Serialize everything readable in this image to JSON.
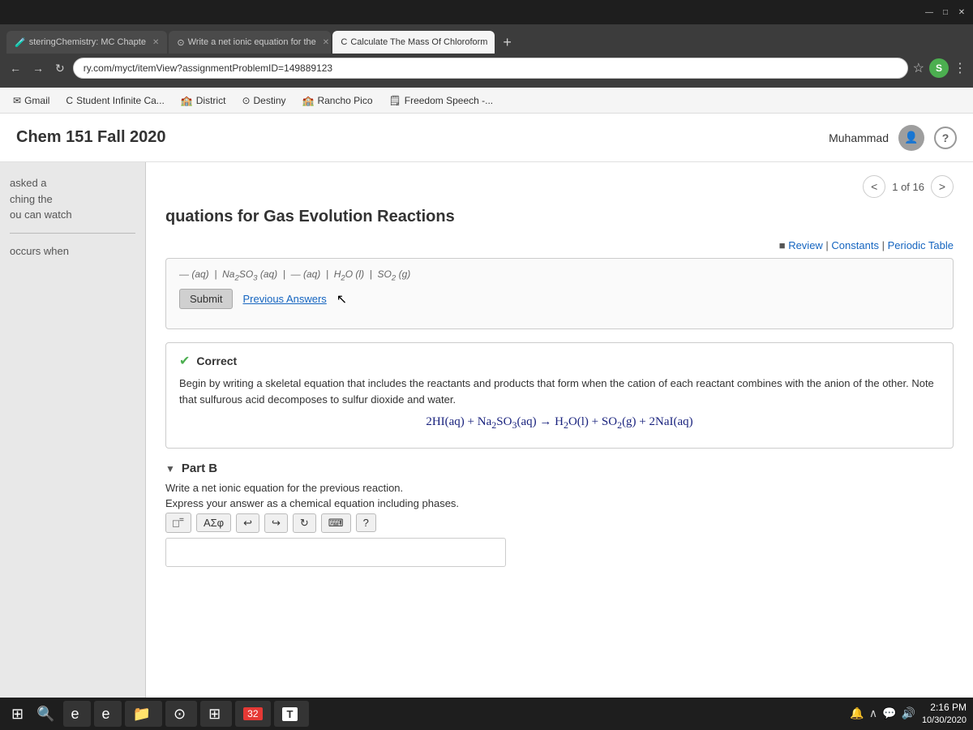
{
  "titlebar": {
    "minimize": "—",
    "maximize": "□",
    "close": "✕"
  },
  "browser": {
    "tabs": [
      {
        "id": "tab1",
        "label": "steringChemistry: MC Chapte",
        "icon": "🧪",
        "active": false
      },
      {
        "id": "tab2",
        "label": "Write a net ionic equation for the",
        "icon": "⊙",
        "active": false
      },
      {
        "id": "tab3",
        "label": "Calculate The Mass Of Chloroform",
        "icon": "C",
        "active": true
      }
    ],
    "address": "ry.com/myct/itemView?assignmentProblemID=149889123",
    "bookmarks": [
      {
        "id": "gmail",
        "label": "Gmail",
        "icon": "✉"
      },
      {
        "id": "student-infinite",
        "label": "Student Infinite Ca...",
        "icon": "C"
      },
      {
        "id": "district",
        "label": "District",
        "icon": "🏫"
      },
      {
        "id": "destiny",
        "label": "Destiny",
        "icon": "⊙"
      },
      {
        "id": "rancho-pico",
        "label": "Rancho Pico",
        "icon": "🏫"
      },
      {
        "id": "freedom-speech",
        "label": "Freedom Speech -...",
        "icon": "🗒"
      }
    ]
  },
  "app": {
    "title": "Chem 151 Fall 2020",
    "user": "Muhammad",
    "help_label": "?"
  },
  "page": {
    "section_title": "quations for Gas Evolution Reactions",
    "nav": {
      "current": "1",
      "total": "16",
      "label": "1 of 16"
    },
    "review_links": "■ Review | Constants | Periodic Table"
  },
  "sidebar": {
    "line1": "asked a",
    "line2": "ching the",
    "line3": "ou can watch",
    "line4": "occurs when"
  },
  "question": {
    "answer_hint": "— (aq) | Na₂SO₃ (aq) | — (aq) | H₂O (l) | —SO₂ (g)",
    "submit_label": "Submit",
    "prev_answers_label": "Previous Answers",
    "correct_label": "Correct",
    "correct_desc": "Begin by writing a skeletal equation that includes the reactants and products that form when the cation of each reactant combines with the anion of the other. Note that sulfurous acid decomposes to sulfur dioxide and water.",
    "equation": "2HI(aq) + Na₂SO₃(aq) → H₂O(l) + SO₂(g) + 2NaI(aq)",
    "part_b_title": "Part B",
    "part_b_line1": "Write a net ionic equation for the previous reaction.",
    "part_b_line2": "Express your answer as a chemical equation including phases.",
    "math_btn1": "□=",
    "math_btn2": "ΑΣφ",
    "math_btn3": "↩",
    "math_btn4": "↪",
    "math_btn5": "↻",
    "math_btn6": "⌨",
    "math_btn7": "?"
  },
  "taskbar": {
    "start_icon": "⊞",
    "search_placeholder": "Search",
    "apps": [
      {
        "id": "ie",
        "icon": "e",
        "label": ""
      },
      {
        "id": "folder",
        "icon": "📁",
        "label": ""
      },
      {
        "id": "chrome",
        "icon": "⊙",
        "label": ""
      },
      {
        "id": "apps-grid",
        "icon": "⊞",
        "label": ""
      },
      {
        "id": "calendar",
        "icon": "32",
        "label": "32"
      },
      {
        "id": "t",
        "icon": "T",
        "label": ""
      }
    ],
    "time": "2:16 PM",
    "date": "10/30/2020",
    "tray_icons": [
      "🔔",
      "∧",
      "💬",
      "🔊"
    ]
  }
}
